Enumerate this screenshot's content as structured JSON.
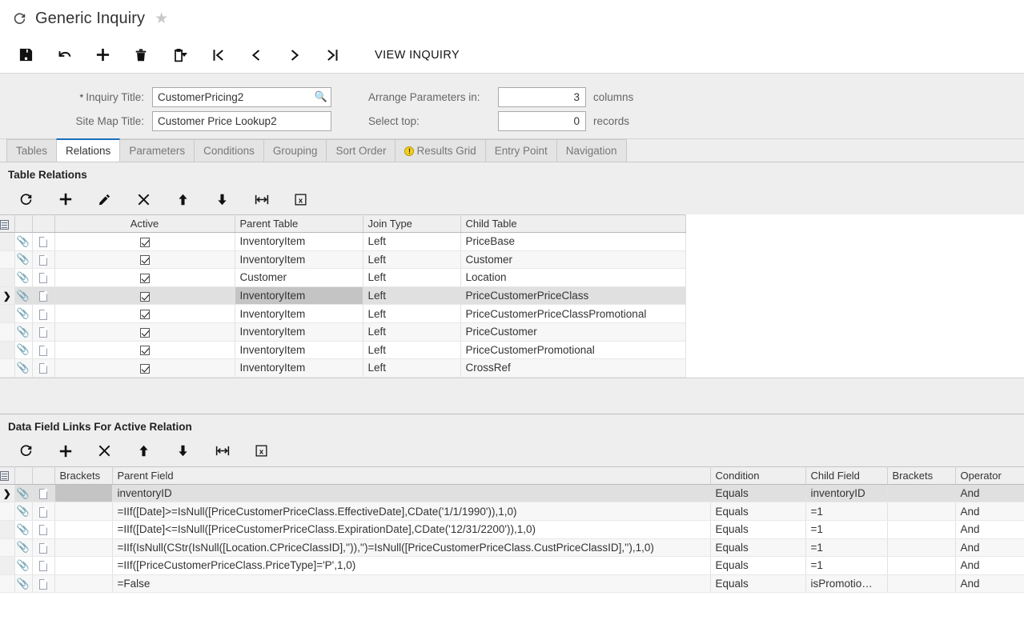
{
  "header": {
    "refresh_icon": "refresh-icon",
    "title": "Generic Inquiry",
    "favorite_icon": "star-icon"
  },
  "toolbar": {
    "buttons": [
      {
        "name": "save-button",
        "icon": "save-icon"
      },
      {
        "name": "undo-button",
        "icon": "undo-arrow-icon"
      },
      {
        "name": "add-button",
        "icon": "plus-icon"
      },
      {
        "name": "delete-button",
        "icon": "trash-icon"
      },
      {
        "name": "clipboard-button",
        "icon": "clipboard-icon"
      },
      {
        "name": "first-record-button",
        "icon": "first-page-icon"
      },
      {
        "name": "previous-record-button",
        "icon": "chevron-left-icon"
      },
      {
        "name": "next-record-button",
        "icon": "chevron-right-icon"
      },
      {
        "name": "last-record-button",
        "icon": "last-page-icon"
      }
    ],
    "view_inquiry_label": "VIEW INQUIRY"
  },
  "form": {
    "inquiry_title_label": "Inquiry Title:",
    "inquiry_title_required": "*",
    "inquiry_title_value": "CustomerPricing2",
    "inquiry_title_lookup_icon": "magnifier-icon",
    "site_map_title_label": "Site Map Title:",
    "site_map_title_value": "Customer Price Lookup2",
    "arrange_params_label": "Arrange Parameters in:",
    "arrange_params_value": "3",
    "arrange_params_suffix": "columns",
    "select_top_label": "Select top:",
    "select_top_value": "0",
    "select_top_suffix": "records"
  },
  "tabs": [
    {
      "label": "Tables",
      "active": false,
      "warn": false
    },
    {
      "label": "Relations",
      "active": true,
      "warn": false
    },
    {
      "label": "Parameters",
      "active": false,
      "warn": false
    },
    {
      "label": "Conditions",
      "active": false,
      "warn": false
    },
    {
      "label": "Grouping",
      "active": false,
      "warn": false
    },
    {
      "label": "Sort Order",
      "active": false,
      "warn": false
    },
    {
      "label": "Results Grid",
      "active": false,
      "warn": true
    },
    {
      "label": "Entry Point",
      "active": false,
      "warn": false
    },
    {
      "label": "Navigation",
      "active": false,
      "warn": false
    }
  ],
  "relations_section": {
    "title": "Table Relations",
    "toolbar": [
      {
        "name": "refresh-button",
        "icon": "refresh-icon"
      },
      {
        "name": "add-row-button",
        "icon": "plus-icon"
      },
      {
        "name": "edit-row-button",
        "icon": "pencil-icon"
      },
      {
        "name": "delete-row-button",
        "icon": "x-icon"
      },
      {
        "name": "move-up-button",
        "icon": "arrow-up-icon"
      },
      {
        "name": "move-down-button",
        "icon": "arrow-down-icon"
      },
      {
        "name": "fit-columns-button",
        "icon": "fit-width-icon"
      },
      {
        "name": "export-excel-button",
        "icon": "excel-icon"
      }
    ],
    "columns": [
      "Active",
      "Parent Table",
      "Join Type",
      "Child Table"
    ],
    "rows": [
      {
        "active": true,
        "parent": "InventoryItem",
        "join": "Left",
        "child": "PriceBase",
        "selected": false
      },
      {
        "active": true,
        "parent": "InventoryItem",
        "join": "Left",
        "child": "Customer",
        "selected": false
      },
      {
        "active": true,
        "parent": "Customer",
        "join": "Left",
        "child": "Location",
        "selected": false
      },
      {
        "active": true,
        "parent": "InventoryItem",
        "join": "Left",
        "child": "PriceCustomerPriceClass",
        "selected": true
      },
      {
        "active": true,
        "parent": "InventoryItem",
        "join": "Left",
        "child": "PriceCustomerPriceClassPromotional",
        "selected": false
      },
      {
        "active": true,
        "parent": "InventoryItem",
        "join": "Left",
        "child": "PriceCustomer",
        "selected": false
      },
      {
        "active": true,
        "parent": "InventoryItem",
        "join": "Left",
        "child": "PriceCustomerPromotional",
        "selected": false
      },
      {
        "active": true,
        "parent": "InventoryItem",
        "join": "Left",
        "child": "CrossRef",
        "selected": false
      }
    ]
  },
  "links_section": {
    "title": "Data Field Links For Active Relation",
    "toolbar": [
      {
        "name": "refresh-button",
        "icon": "refresh-icon"
      },
      {
        "name": "add-row-button",
        "icon": "plus-icon"
      },
      {
        "name": "delete-row-button",
        "icon": "x-icon"
      },
      {
        "name": "move-up-button",
        "icon": "arrow-up-icon"
      },
      {
        "name": "move-down-button",
        "icon": "arrow-down-icon"
      },
      {
        "name": "fit-columns-button",
        "icon": "fit-width-icon"
      },
      {
        "name": "export-excel-button",
        "icon": "excel-icon"
      }
    ],
    "columns": [
      "Brackets",
      "Parent Field",
      "Condition",
      "Child Field",
      "Brackets",
      "Operator"
    ],
    "rows": [
      {
        "brackets_l": "",
        "parent_field": "inventoryID",
        "condition": "Equals",
        "child_field": "inventoryID",
        "brackets_r": "",
        "operator": "And",
        "selected": true
      },
      {
        "brackets_l": "",
        "parent_field": "=IIf([Date]>=IsNull([PriceCustomerPriceClass.EffectiveDate],CDate('1/1/1990')),1,0)",
        "condition": "Equals",
        "child_field": "=1",
        "brackets_r": "",
        "operator": "And",
        "selected": false
      },
      {
        "brackets_l": "",
        "parent_field": "=IIf([Date]<=IsNull([PriceCustomerPriceClass.ExpirationDate],CDate('12/31/2200')),1,0)",
        "condition": "Equals",
        "child_field": "=1",
        "brackets_r": "",
        "operator": "And",
        "selected": false
      },
      {
        "brackets_l": "",
        "parent_field": "=IIf(IsNull(CStr(IsNull([Location.CPriceClassID],'')),'')=IsNull([PriceCustomerPriceClass.CustPriceClassID],''),1,0)",
        "condition": "Equals",
        "child_field": "=1",
        "brackets_r": "",
        "operator": "And",
        "selected": false
      },
      {
        "brackets_l": "",
        "parent_field": "=IIf([PriceCustomerPriceClass.PriceType]='P',1,0)",
        "condition": "Equals",
        "child_field": "=1",
        "brackets_r": "",
        "operator": "And",
        "selected": false
      },
      {
        "brackets_l": "",
        "parent_field": "=False",
        "condition": "Equals",
        "child_field": "isPromotio…",
        "brackets_r": "",
        "operator": "And",
        "selected": false
      }
    ]
  },
  "colors": {
    "accent": "#1a6fba",
    "panel_bg": "#eeeeee",
    "grid_header_bg": "#efefef",
    "selected_row": "#e0e0e0",
    "active_cell": "#c4c4c4",
    "warn_badge": "#f2d024"
  }
}
